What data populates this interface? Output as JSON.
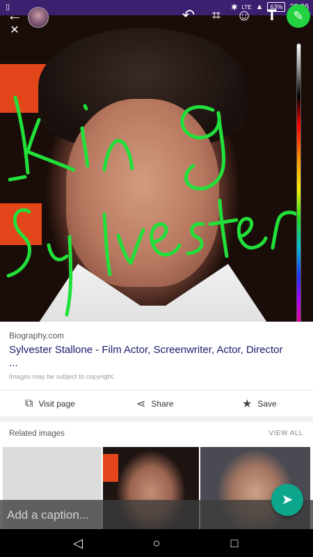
{
  "status_bar": {
    "network": "LTE",
    "battery": "63%",
    "time": "22:36"
  },
  "editor": {
    "annotation_color": "#22e03a",
    "annotation_lines": [
      "-King",
      "Sylvester"
    ],
    "tools": [
      "back-icon",
      "close-icon",
      "undo-icon",
      "crop-icon",
      "emoji-icon",
      "text-icon",
      "pencil-icon"
    ]
  },
  "result_card": {
    "source": "Biography.com",
    "title": "Sylvester Stallone - Film Actor, Screenwriter, Actor, Director",
    "title_continuation": "...",
    "copyright_note": "Images may be subject to copyright.",
    "actions": {
      "visit": "Visit page",
      "share": "Share",
      "save": "Save"
    }
  },
  "related": {
    "label": "Related images",
    "view_all": "VIEW ALL"
  },
  "caption": {
    "placeholder": "Add a caption..."
  },
  "colors": {
    "status_bar": "#3c1f6e",
    "pencil_active": "#22d241",
    "send_button": "#0ea58d",
    "link_title": "#1a1a6e"
  }
}
